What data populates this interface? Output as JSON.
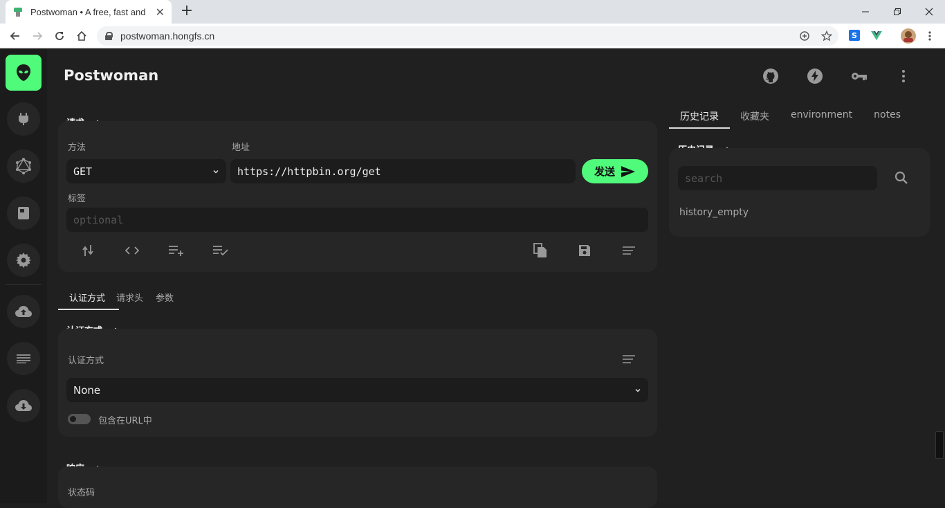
{
  "browser": {
    "tab_title": "Postwoman • A free, fast and b",
    "url": "postwoman.hongfs.cn",
    "new_tab_label": "+",
    "tab_close_label": "✕"
  },
  "app": {
    "brand": "Postwoman",
    "accent_color": "#50fa7b",
    "sidebar_icons": [
      "alien-icon",
      "plug-icon",
      "graphql-icon",
      "book-icon",
      "settings-icon",
      "cloud-upload-icon",
      "list-icon",
      "cloud-download-icon"
    ],
    "header_icons": [
      "github-icon",
      "lightning-icon",
      "key-icon",
      "more-vert-icon"
    ]
  },
  "request": {
    "section_title": "请求",
    "method_label": "方法",
    "method_value": "GET",
    "url_label": "地址",
    "url_value": "https://httpbin.org/get",
    "send_label": "发送",
    "label_label": "标签",
    "label_placeholder": "optional"
  },
  "subtabs": [
    "认证方式",
    "请求头",
    "参数"
  ],
  "auth": {
    "section_title": "认证方式",
    "type_label": "认证方式",
    "type_value": "None",
    "include_in_url": "包含在URL中"
  },
  "response": {
    "section_title": "响应",
    "status_label": "状态码"
  },
  "right": {
    "tabs": [
      "历史记录",
      "收藏夹",
      "environment",
      "notes"
    ],
    "history_title": "历史记录",
    "search_placeholder": "search",
    "empty_text": "history_empty"
  }
}
